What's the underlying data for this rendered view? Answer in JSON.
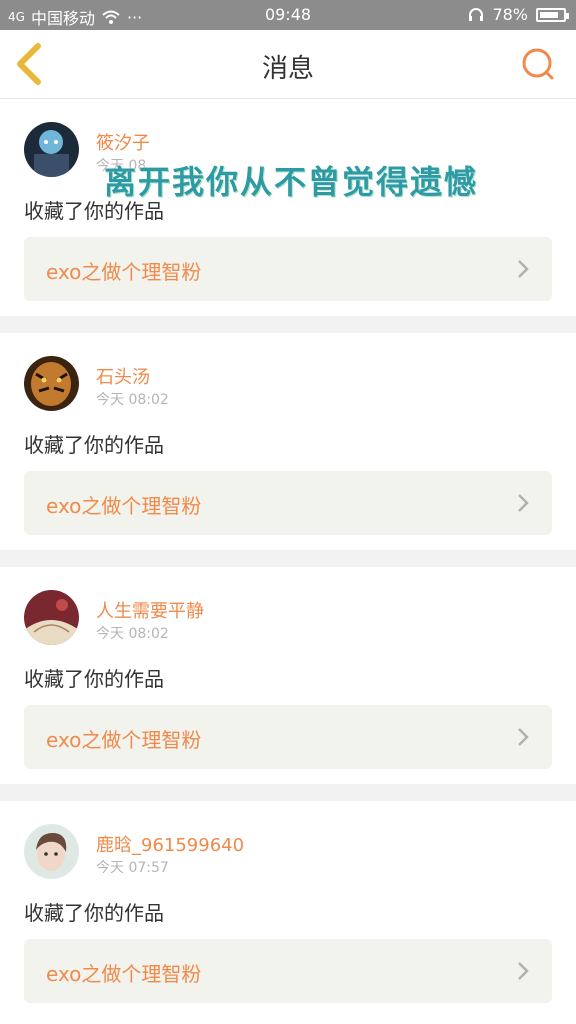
{
  "status_bar": {
    "signal": "4G",
    "carrier": "中国移动",
    "more": "···",
    "time": "09:48",
    "battery": "78%"
  },
  "header": {
    "title": "消息"
  },
  "overlay": {
    "line1": "遗憾",
    "line2": "离开我你从不曾觉得遗憾"
  },
  "messages": [
    {
      "username": "筱汐子",
      "time": "今天 08",
      "action": "收藏了你的作品",
      "work": "exo之做个理智粉"
    },
    {
      "username": "石头汤",
      "time": "今天 08:02",
      "action": "收藏了你的作品",
      "work": "exo之做个理智粉"
    },
    {
      "username": "人生需要平静",
      "time": "今天 08:02",
      "action": "收藏了你的作品",
      "work": "exo之做个理智粉"
    },
    {
      "username": "鹿晗_961599640",
      "time": "今天 07:57",
      "action": "收藏了你的作品",
      "work": "exo之做个理智粉"
    }
  ],
  "colors": {
    "accent": "#f08a4b",
    "back_icon": "#e8b83a",
    "card_bg": "#f3f3ee"
  }
}
